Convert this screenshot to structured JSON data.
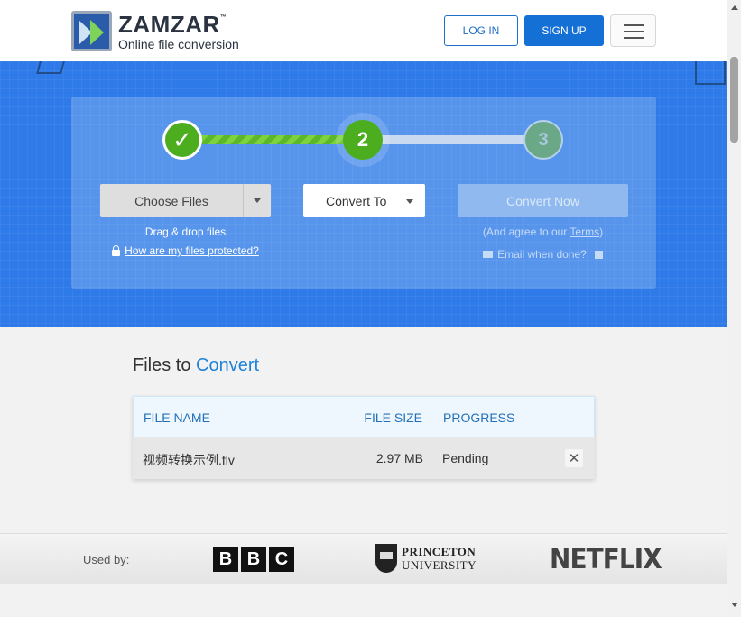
{
  "header": {
    "logo_name": "ZAMZAR",
    "logo_tm": "™",
    "logo_tagline": "Online file conversion",
    "login_label": "LOG IN",
    "signup_label": "SIGN UP"
  },
  "steps": {
    "step1": "✓",
    "step2": "2",
    "step3": "3"
  },
  "converter": {
    "choose_files_label": "Choose Files",
    "drag_drop_text": "Drag & drop files",
    "protected_link": "How are my files protected?",
    "convert_to_label": "Convert To",
    "convert_now_label": "Convert Now",
    "agree_prefix": "(And agree to our ",
    "terms_link": "Terms",
    "agree_suffix": ")",
    "email_label": "Email when done?"
  },
  "files": {
    "title_prefix": "Files to ",
    "title_accent": "Convert",
    "columns": {
      "file_name": "FILE NAME",
      "file_size": "FILE SIZE",
      "progress": "PROGRESS"
    },
    "rows": [
      {
        "name": "视频转换示例.flv",
        "size": "2.97 MB",
        "progress": "Pending",
        "remove": "✕"
      }
    ]
  },
  "used_by": {
    "label": "Used by:",
    "bbc": [
      "B",
      "B",
      "C"
    ],
    "princeton_line1": "PRINCETON",
    "princeton_line2": "UNIVERSITY",
    "netflix": "NETFLIX"
  },
  "colors": {
    "brand_blue": "#2e7ae8",
    "button_blue": "#1570d6",
    "step_green": "#4cae1e",
    "accent_blue": "#1e82d9"
  }
}
